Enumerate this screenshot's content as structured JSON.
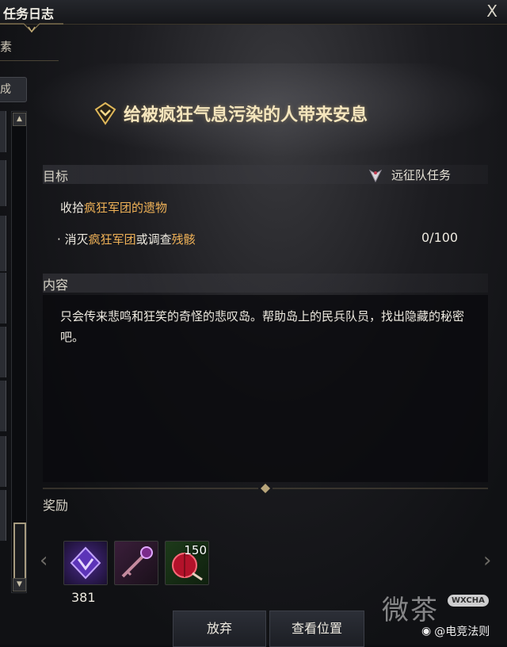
{
  "window": {
    "title": "任务日志",
    "close_label": "X"
  },
  "sidebar": {
    "tab_label": "素",
    "button_label": "成"
  },
  "quest": {
    "title": "给被疯狂气息污染的人带来安息",
    "objectives_label": "目标",
    "quest_type": "远征队任务",
    "objective_main": {
      "prefix": "收拾",
      "highlight": "疯狂军团的遗物"
    },
    "objective_sub": {
      "bullet": "·",
      "part1": "消灭",
      "highlight1": "疯狂军团",
      "part2": "或调查",
      "highlight2": "残骸"
    },
    "progress": "0/100",
    "content_label": "内容",
    "content_text": "只会传来悲鸣和狂笑的奇怪的悲叹岛。帮助岛上的民兵队员，找出隐藏的秘密吧。"
  },
  "rewards": {
    "label": "奖励",
    "items": [
      {
        "icon": "purple-crystal-icon",
        "quantity": "381",
        "badge": ""
      },
      {
        "icon": "key-icon",
        "quantity": "",
        "badge": ""
      },
      {
        "icon": "red-potion-icon",
        "quantity": "",
        "badge": "150"
      }
    ],
    "prev_arrow": "‹",
    "next_arrow": "›"
  },
  "buttons": {
    "abandon": "放弃",
    "view_location": "查看位置"
  },
  "watermark": {
    "text": "微茶",
    "badge": "WXCHA",
    "user": "@电竞法则"
  },
  "colors": {
    "highlight": "#f0b257",
    "title_gold": "#f5e6bd"
  }
}
